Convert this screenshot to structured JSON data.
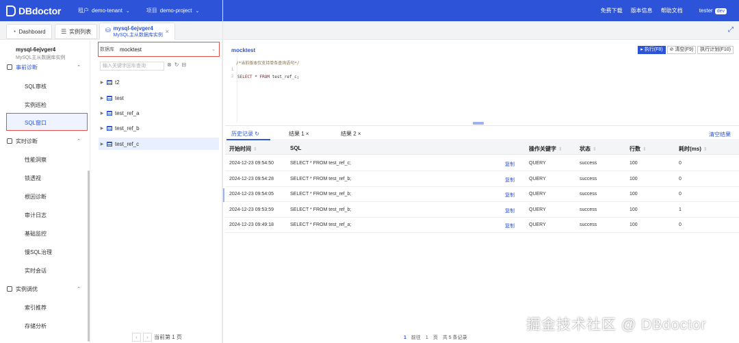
{
  "topbar": {
    "logo": "DBdoctor",
    "tenant_label": "租户",
    "tenant_value": "demo-tenant",
    "project_label": "项目",
    "project_value": "demo-project",
    "links": [
      "免费下载",
      "版本信息",
      "帮助文档"
    ],
    "user": "tester",
    "user_badge": "dev"
  },
  "tabs": {
    "dashboard": "Dashboard",
    "instance_list": "实例列表",
    "active_title": "mysql-6ejvger4",
    "active_subtitle": "MySQL主从数据库实例"
  },
  "sidebar": {
    "instance_name": "mysql-6ejvger4",
    "instance_type": "MySQL主从数据库实例",
    "groups": [
      {
        "label": "事前诊断",
        "items": [
          "SQL审核",
          "实例巡检",
          "SQL窗口"
        ]
      },
      {
        "label": "实时诊断",
        "items": [
          "性能洞察",
          "锁透视",
          "根因诊断",
          "审计日志",
          "基础监控",
          "慢SQL治理",
          "实时会话"
        ]
      },
      {
        "label": "实例调优",
        "items": [
          "索引推荐",
          "存储分析"
        ]
      }
    ]
  },
  "dbpanel": {
    "db_label": "数据库",
    "db_value": "mocktest",
    "search_placeholder": "输入关键字回车查询",
    "tables": [
      "t2",
      "test",
      "test_ref_a",
      "test_ref_b",
      "test_ref_c"
    ],
    "pager_text": "当前第 1 页"
  },
  "editor": {
    "db_name": "mocktest",
    "run_label": "执行(F8)",
    "clear_label": "清空(F9)",
    "plan_label": "执行计划(F10)",
    "comment": "/*当前版本仅支持单条查询语句*/",
    "sql_keyword1": "SELECT",
    "sql_keyword2": "FROM",
    "sql_rest": " test_ref_c;",
    "line1": "1",
    "line2": "2"
  },
  "results": {
    "tabs": [
      "历史记录",
      "结果 1",
      "结果 2"
    ],
    "clear_label": "清空结果",
    "columns": [
      "开始时间",
      "SQL",
      "操作关键字",
      "状态",
      "行数",
      "耗时(ms)"
    ],
    "copy_label": "复制",
    "rows": [
      {
        "time": "2024-12-23 09:54:50",
        "sql": "SELECT * FROM test_ref_c;",
        "kw": "QUERY",
        "status": "success",
        "rows": "100",
        "ms": "0"
      },
      {
        "time": "2024-12-23 09:54:28",
        "sql": "SELECT * FROM test_ref_b;",
        "kw": "QUERY",
        "status": "success",
        "rows": "100",
        "ms": "0"
      },
      {
        "time": "2024-12-23 09:54:05",
        "sql": "SELECT * FROM test_ref_b;",
        "kw": "QUERY",
        "status": "success",
        "rows": "100",
        "ms": "0"
      },
      {
        "time": "2024-12-23 09:53:59",
        "sql": "SELECT * FROM test_ref_b;",
        "kw": "QUERY",
        "status": "success",
        "rows": "100",
        "ms": "1"
      },
      {
        "time": "2024-12-23 09:49:18",
        "sql": "SELECT * FROM test_ref_a;",
        "kw": "QUERY",
        "status": "success",
        "rows": "100",
        "ms": "0"
      }
    ],
    "pager": {
      "current": "1",
      "goto_label": "前往",
      "goto_value": "1",
      "page_unit": "页",
      "total": "共 5 条记录"
    }
  },
  "watermark": "掘金技术社区 @ DBdoctor"
}
